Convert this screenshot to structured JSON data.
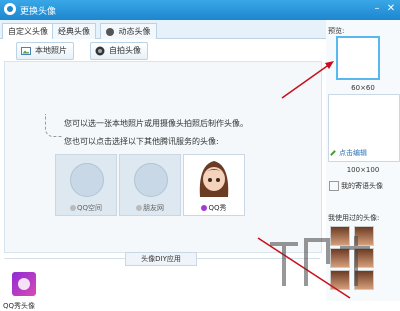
{
  "window": {
    "title": "更换头像"
  },
  "tabs": [
    {
      "label": "自定义头像"
    },
    {
      "label": "经典头像"
    },
    {
      "label": "动态头像"
    }
  ],
  "toolbar": {
    "local_photo": "本地照片",
    "selfie": "自拍头像"
  },
  "hints": {
    "line1": "您可以选一张本地照片或用摄像头拍照后制作头像。",
    "line2": "您也可以点击选择以下其他腾讯服务的头像:"
  },
  "apps": [
    {
      "label": "QQ空间"
    },
    {
      "label": "朋友网"
    },
    {
      "label": "QQ秀"
    }
  ],
  "diy": {
    "label": "头像DIY应用"
  },
  "qqshow_avatar": {
    "label": "QQ秀头像"
  },
  "side": {
    "preview_label": "预览:",
    "size_small": "60×60",
    "edit_link": "点击编辑",
    "size_large": "100×100",
    "my_show": "我的寄语头像",
    "used_label": "我使用过的头像:"
  }
}
